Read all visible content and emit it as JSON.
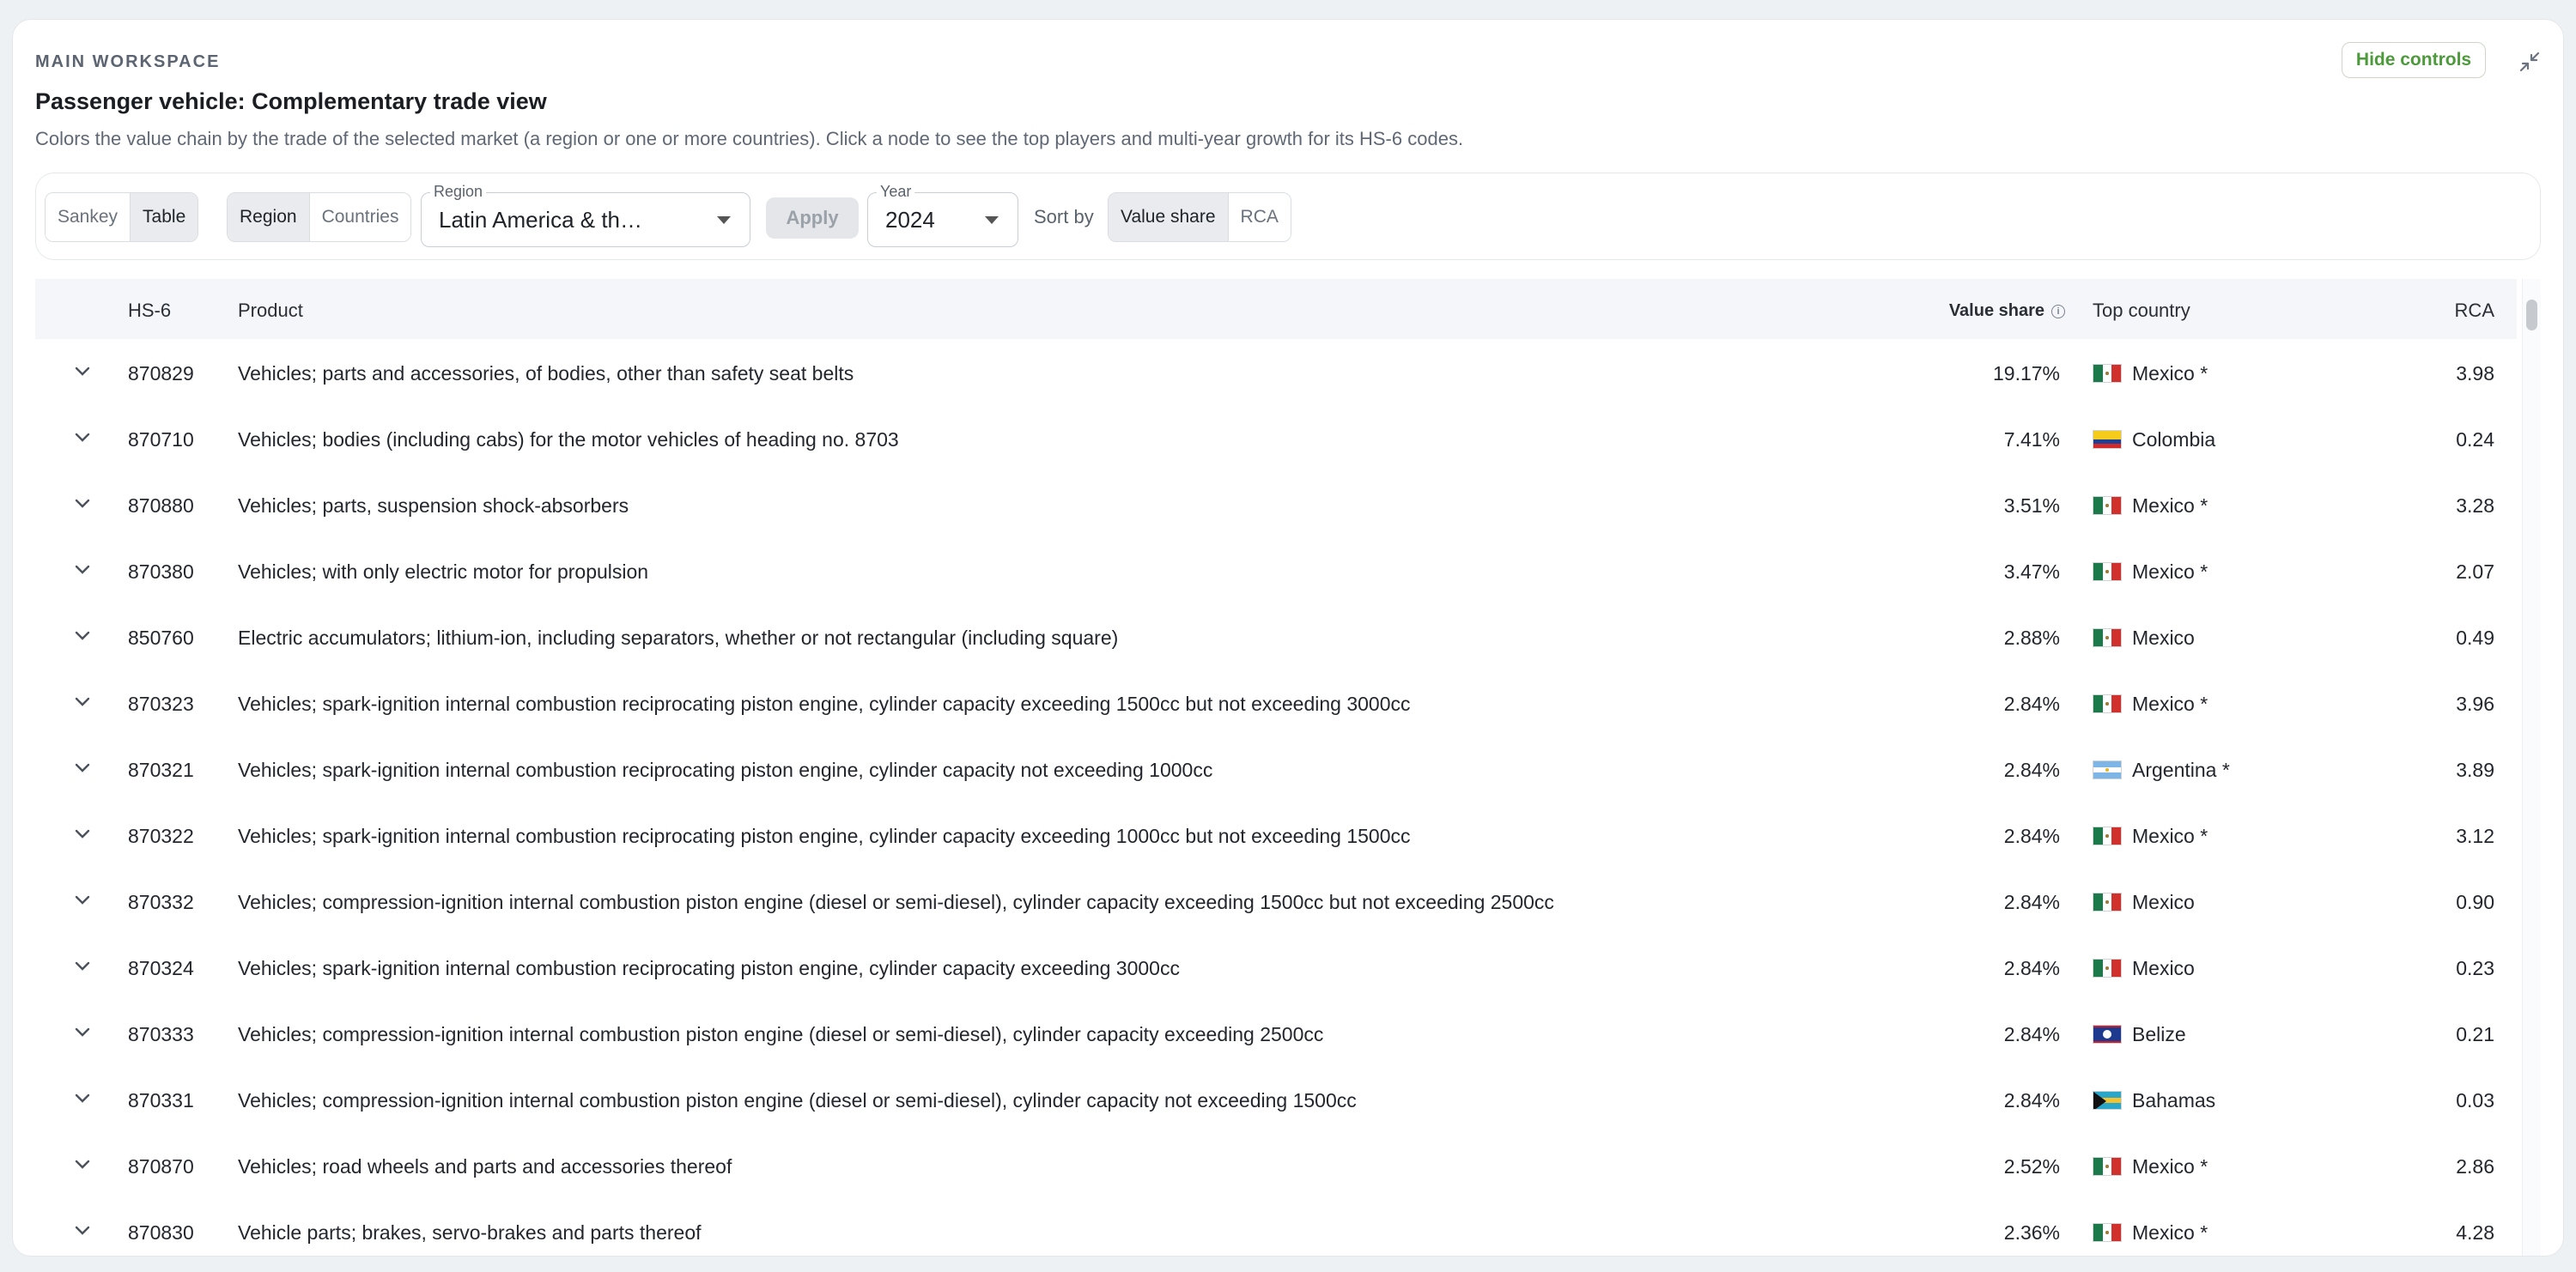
{
  "header": {
    "eyebrow": "MAIN WORKSPACE",
    "title": "Passenger vehicle: Complementary trade view",
    "subtitle": "Colors the value chain by the trade of the selected market (a region or one or more countries). Click a node to see the top players and multi-year growth for its HS-6 codes.",
    "hide_controls_label": "Hide controls"
  },
  "controls": {
    "view_toggle": [
      {
        "label": "Sankey",
        "active": false
      },
      {
        "label": "Table",
        "active": true
      }
    ],
    "scope_toggle": [
      {
        "label": "Region",
        "active": true
      },
      {
        "label": "Countries",
        "active": false
      }
    ],
    "region_label": "Region",
    "region_value": "Latin America & th…",
    "apply_label": "Apply",
    "year_label": "Year",
    "year_value": "2024",
    "sort_by_label": "Sort by",
    "sort_toggle": [
      {
        "label": "Value share",
        "active": true
      },
      {
        "label": "RCA",
        "active": false
      }
    ]
  },
  "table": {
    "columns": {
      "hs6": "HS-6",
      "product": "Product",
      "value_share": "Value share",
      "top_country": "Top country",
      "rca": "RCA"
    },
    "rows": [
      {
        "hs6": "870829",
        "product": "Vehicles; parts and accessories, of bodies, other than safety seat belts",
        "value_share": "19.17%",
        "top_country": "Mexico *",
        "flag": "mexico",
        "rca": "3.98"
      },
      {
        "hs6": "870710",
        "product": "Vehicles; bodies (including cabs) for the motor vehicles of heading no. 8703",
        "value_share": "7.41%",
        "top_country": "Colombia",
        "flag": "colombia",
        "rca": "0.24"
      },
      {
        "hs6": "870880",
        "product": "Vehicles; parts, suspension shock-absorbers",
        "value_share": "3.51%",
        "top_country": "Mexico *",
        "flag": "mexico",
        "rca": "3.28"
      },
      {
        "hs6": "870380",
        "product": "Vehicles; with only electric motor for propulsion",
        "value_share": "3.47%",
        "top_country": "Mexico *",
        "flag": "mexico",
        "rca": "2.07"
      },
      {
        "hs6": "850760",
        "product": "Electric accumulators; lithium-ion, including separators, whether or not rectangular (including square)",
        "value_share": "2.88%",
        "top_country": "Mexico",
        "flag": "mexico",
        "rca": "0.49"
      },
      {
        "hs6": "870323",
        "product": "Vehicles; spark-ignition internal combustion reciprocating piston engine, cylinder capacity exceeding 1500cc but not exceeding 3000cc",
        "value_share": "2.84%",
        "top_country": "Mexico *",
        "flag": "mexico",
        "rca": "3.96"
      },
      {
        "hs6": "870321",
        "product": "Vehicles; spark-ignition internal combustion reciprocating piston engine, cylinder capacity not exceeding 1000cc",
        "value_share": "2.84%",
        "top_country": "Argentina *",
        "flag": "argentina",
        "rca": "3.89"
      },
      {
        "hs6": "870322",
        "product": "Vehicles; spark-ignition internal combustion reciprocating piston engine, cylinder capacity exceeding 1000cc but not exceeding 1500cc",
        "value_share": "2.84%",
        "top_country": "Mexico *",
        "flag": "mexico",
        "rca": "3.12"
      },
      {
        "hs6": "870332",
        "product": "Vehicles; compression-ignition internal combustion piston engine (diesel or semi-diesel), cylinder capacity exceeding 1500cc but not exceeding 2500cc",
        "value_share": "2.84%",
        "top_country": "Mexico",
        "flag": "mexico",
        "rca": "0.90"
      },
      {
        "hs6": "870324",
        "product": "Vehicles; spark-ignition internal combustion reciprocating piston engine, cylinder capacity exceeding 3000cc",
        "value_share": "2.84%",
        "top_country": "Mexico",
        "flag": "mexico",
        "rca": "0.23"
      },
      {
        "hs6": "870333",
        "product": "Vehicles; compression-ignition internal combustion piston engine (diesel or semi-diesel), cylinder capacity exceeding 2500cc",
        "value_share": "2.84%",
        "top_country": "Belize",
        "flag": "belize",
        "rca": "0.21"
      },
      {
        "hs6": "870331",
        "product": "Vehicles; compression-ignition internal combustion piston engine (diesel or semi-diesel), cylinder capacity not exceeding 1500cc",
        "value_share": "2.84%",
        "top_country": "Bahamas",
        "flag": "bahamas",
        "rca": "0.03"
      },
      {
        "hs6": "870870",
        "product": "Vehicles; road wheels and parts and accessories thereof",
        "value_share": "2.52%",
        "top_country": "Mexico *",
        "flag": "mexico",
        "rca": "2.86"
      },
      {
        "hs6": "870830",
        "product": "Vehicle parts; brakes, servo-brakes and parts thereof",
        "value_share": "2.36%",
        "top_country": "Mexico *",
        "flag": "mexico",
        "rca": "4.28"
      }
    ]
  },
  "colors": {
    "accent_green": "#4c9a3a",
    "active_segment": "#e9ebee"
  },
  "icons": {
    "collapse": "collapse-arrows-icon",
    "info": "info-circle-icon",
    "expand": "chevron-down-icon",
    "dropdown": "caret-down-icon"
  }
}
